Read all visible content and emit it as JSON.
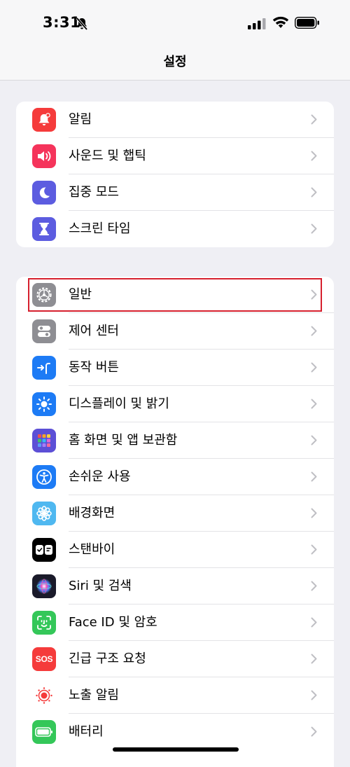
{
  "status": {
    "time": "3:31"
  },
  "nav": {
    "title": "설정"
  },
  "groups": [
    {
      "items": [
        {
          "label": "알림",
          "icon": "bell-icon",
          "color": "#f53b3b"
        },
        {
          "label": "사운드 및 햅틱",
          "icon": "speaker-icon",
          "color": "#f5345b"
        },
        {
          "label": "집중 모드",
          "icon": "moon-icon",
          "color": "#5c5ce0"
        },
        {
          "label": "스크린 타임",
          "icon": "hourglass-icon",
          "color": "#5c5ce0"
        }
      ]
    },
    {
      "items": [
        {
          "label": "일반",
          "icon": "gear-icon",
          "color": "#8e8e93"
        },
        {
          "label": "제어 센터",
          "icon": "switches-icon",
          "color": "#8e8e93"
        },
        {
          "label": "동작 버튼",
          "icon": "action-button-icon",
          "color": "#1d7bf5"
        },
        {
          "label": "디스플레이 및 밝기",
          "icon": "sun-icon",
          "color": "#1d7bf5"
        },
        {
          "label": "홈 화면 및 앱 보관함",
          "icon": "app-grid-icon",
          "color": "#5c4fd6"
        },
        {
          "label": "손쉬운 사용",
          "icon": "accessibility-icon",
          "color": "#1d7bf5"
        },
        {
          "label": "배경화면",
          "icon": "flower-icon",
          "color": "#4fb8f0"
        },
        {
          "label": "스탠바이",
          "icon": "standby-icon",
          "color": "#000000"
        },
        {
          "label": "Siri 및 검색",
          "icon": "siri-icon",
          "color": "#1a1a2a"
        },
        {
          "label": "Face ID 및 암호",
          "icon": "face-id-icon",
          "color": "#34c759"
        },
        {
          "label": "긴급 구조 요청",
          "icon": "sos-icon",
          "color": "#f53b3b"
        },
        {
          "label": "노출 알림",
          "icon": "exposure-icon",
          "color": "#ffffff"
        },
        {
          "label": "배터리",
          "icon": "battery-icon",
          "color": "#34c759"
        }
      ]
    }
  ],
  "sos_text": "SOS"
}
